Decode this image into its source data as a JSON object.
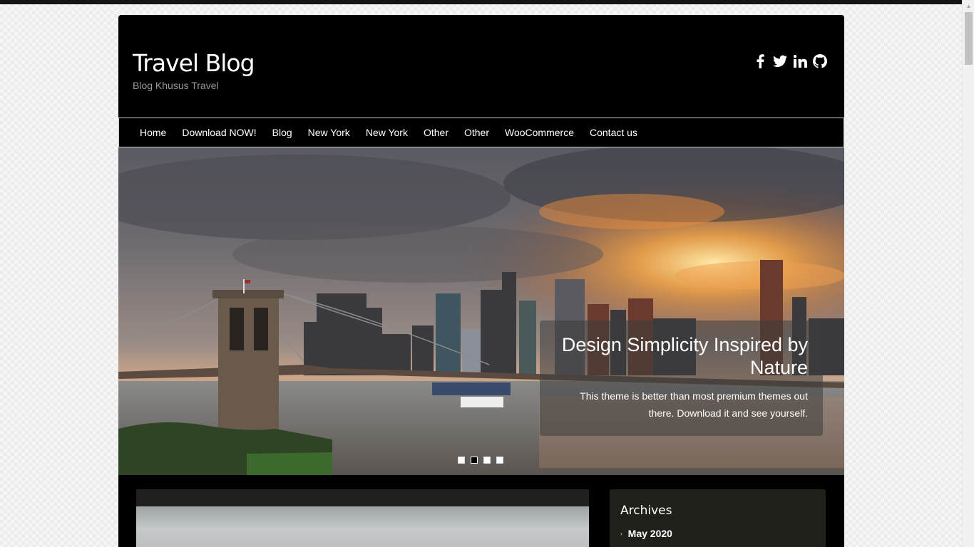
{
  "site": {
    "title": "Travel Blog",
    "tagline": "Blog Khusus Travel"
  },
  "social": [
    "facebook-icon",
    "twitter-icon",
    "linkedin-icon",
    "github-icon"
  ],
  "nav": {
    "items": [
      "Home",
      "Download NOW!",
      "Blog",
      "New York",
      "New York",
      "Other",
      "Other",
      "WooCommerce",
      "Contact us"
    ]
  },
  "slider": {
    "heading": "Design Simplicity Inspired by Nature",
    "text": "This theme is better than most premium themes out there. Download it and see yourself.",
    "slides": 4,
    "active_slide": 2
  },
  "sidebar": {
    "widget_title": "Archives",
    "archives": [
      "May 2020"
    ]
  },
  "colors": {
    "background": "#ececec",
    "page": "#000000",
    "widget": "#20201b",
    "text": "#ffffff"
  }
}
